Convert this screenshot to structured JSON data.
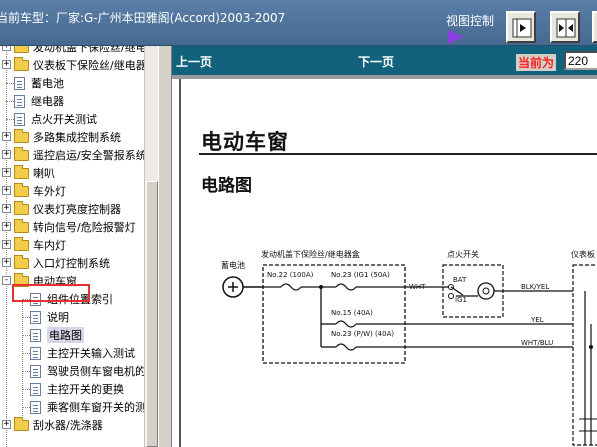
{
  "header": {
    "car_model": "当前车型：厂家:G-广州本田雅阁(Accord)2003-2007",
    "view_control": "视图控制"
  },
  "tree": {
    "items": [
      {
        "label": "发动机盖下保险丝/继电",
        "type": "folder",
        "expander": "+"
      },
      {
        "label": "仪表板下保险丝/继电器",
        "type": "folder",
        "expander": "+"
      },
      {
        "label": "蓄电池",
        "type": "doc",
        "expander": ""
      },
      {
        "label": "继电器",
        "type": "doc",
        "expander": ""
      },
      {
        "label": "点火开关测试",
        "type": "doc",
        "expander": ""
      },
      {
        "label": "多路集成控制系统",
        "type": "folder",
        "expander": "+"
      },
      {
        "label": "遥控启运/安全警报系统",
        "type": "folder",
        "expander": "+"
      },
      {
        "label": "喇叭",
        "type": "folder",
        "expander": "+"
      },
      {
        "label": "车外灯",
        "type": "folder",
        "expander": "+"
      },
      {
        "label": "仪表灯亮度控制器",
        "type": "folder",
        "expander": "+"
      },
      {
        "label": "转向信号/危险报警灯",
        "type": "folder",
        "expander": "+"
      },
      {
        "label": "车内灯",
        "type": "folder",
        "expander": "+"
      },
      {
        "label": "入口灯控制系统",
        "type": "folder",
        "expander": "+"
      },
      {
        "label": "电动车窗",
        "type": "folder-open",
        "expander": "-"
      },
      {
        "label": "组件位置索引",
        "type": "child",
        "expander": ""
      },
      {
        "label": "说明",
        "type": "child",
        "expander": ""
      },
      {
        "label": "电路图",
        "type": "child-selected",
        "expander": ""
      },
      {
        "label": "主控开关输入测试",
        "type": "child",
        "expander": ""
      },
      {
        "label": "驾驶员侧车窗电机的",
        "type": "child",
        "expander": ""
      },
      {
        "label": "主控开关的更换",
        "type": "child",
        "expander": ""
      },
      {
        "label": "乘客侧车窗开关的测",
        "type": "child",
        "expander": ""
      },
      {
        "label": "刮水器/洗涤器",
        "type": "folder",
        "expander": "+"
      }
    ]
  },
  "nav": {
    "prev": "上一页",
    "next": "下一页",
    "current_label": "当前为",
    "current_value": "220"
  },
  "page": {
    "title": "电动车窗",
    "subtitle": "电路图"
  },
  "diagram": {
    "battery_label": "蓄电池",
    "fuse_box_label": "发动机盖下保险丝/继电器盒",
    "ignition_label": "点火开关",
    "instrument_label": "仪表板",
    "fuse1": "No.22 (100A)",
    "fuse2": "No.23 (IG1 (50A)",
    "fuse3": "No.15 (40A)",
    "fuse4": "No.23 (P/W) (40A)",
    "bat": "BAT",
    "ig1": "IG1",
    "wire1": "WHT",
    "wire2": "BLK/YEL",
    "wire3": "YEL",
    "wire4": "WHT/BLU"
  },
  "colors": {
    "nav_bg": "#13627d",
    "top_bg": "#4f74a0",
    "highlight": "#e83030",
    "accent_arrow": "#8c3fe0"
  }
}
